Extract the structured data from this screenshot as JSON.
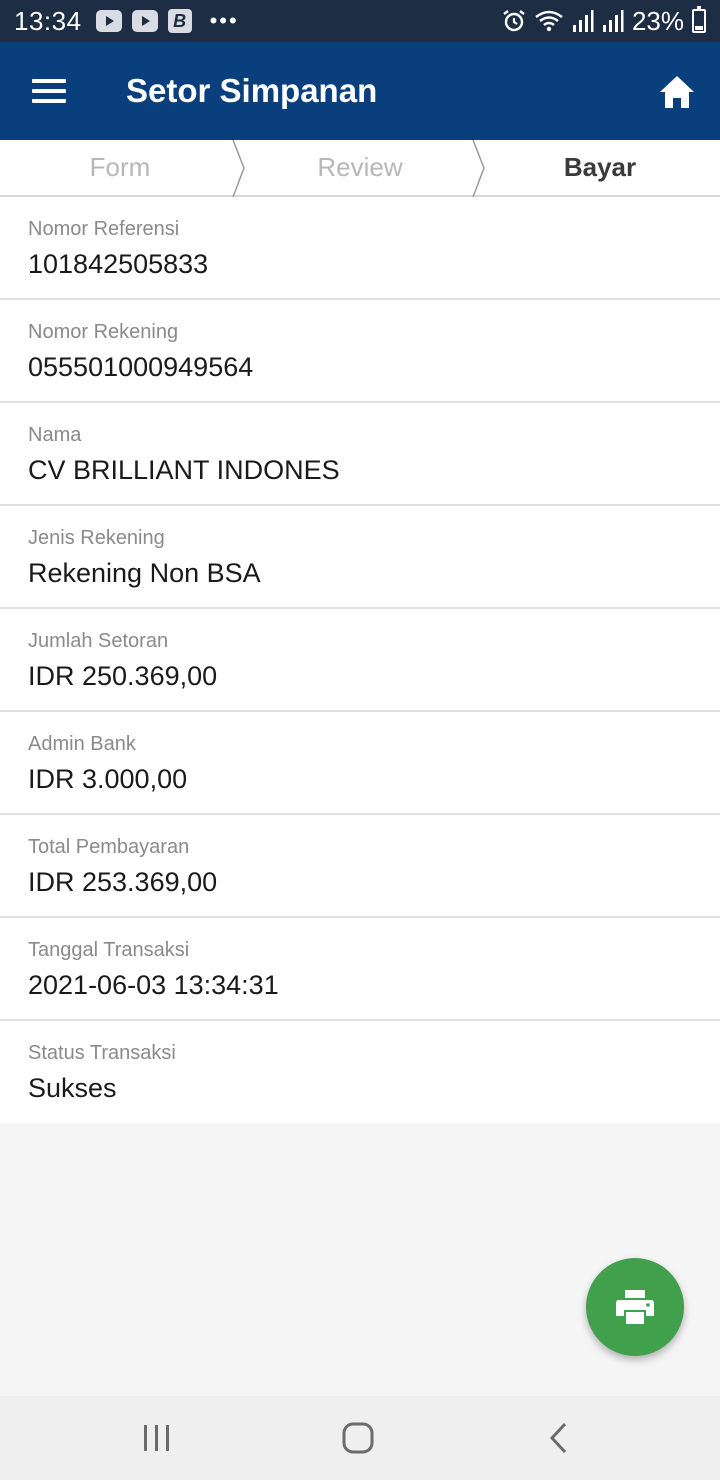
{
  "status_bar": {
    "time": "13:34",
    "battery": "23%",
    "icons": [
      "youtube-icon",
      "youtube-icon",
      "b-app-icon",
      "more-dots-icon",
      "alarm-icon",
      "wifi-icon",
      "signal-icon",
      "signal-icon",
      "battery-icon"
    ],
    "b_app_letter": "B",
    "dots": "•••"
  },
  "app_bar": {
    "title": "Setor Simpanan",
    "menu_icon": "hamburger-menu-icon",
    "home_icon": "home-icon"
  },
  "stepper": {
    "steps": [
      {
        "label": "Form",
        "active": false
      },
      {
        "label": "Review",
        "active": false
      },
      {
        "label": "Bayar",
        "active": true
      }
    ]
  },
  "details": [
    {
      "label": "Nomor Referensi",
      "value": "101842505833"
    },
    {
      "label": "Nomor Rekening",
      "value": "055501000949564"
    },
    {
      "label": "Nama",
      "value": "CV BRILLIANT INDONES"
    },
    {
      "label": "Jenis Rekening",
      "value": "Rekening Non BSA"
    },
    {
      "label": "Jumlah Setoran",
      "value": "IDR 250.369,00"
    },
    {
      "label": "Admin Bank",
      "value": "IDR 3.000,00"
    },
    {
      "label": "Total Pembayaran",
      "value": "IDR 253.369,00"
    },
    {
      "label": "Tanggal Transaksi",
      "value": "2021-06-03 13:34:31"
    },
    {
      "label": "Status Transaksi",
      "value": "Sukses"
    }
  ],
  "fab": {
    "icon": "print-icon"
  },
  "nav_bar": {
    "icons": [
      "recent-apps-icon",
      "home-button-icon",
      "back-icon"
    ]
  },
  "colors": {
    "status_bar": "#1c2d44",
    "app_bar": "#0a3f7e",
    "fab": "#40a04b",
    "background": "#f5f5f5"
  }
}
